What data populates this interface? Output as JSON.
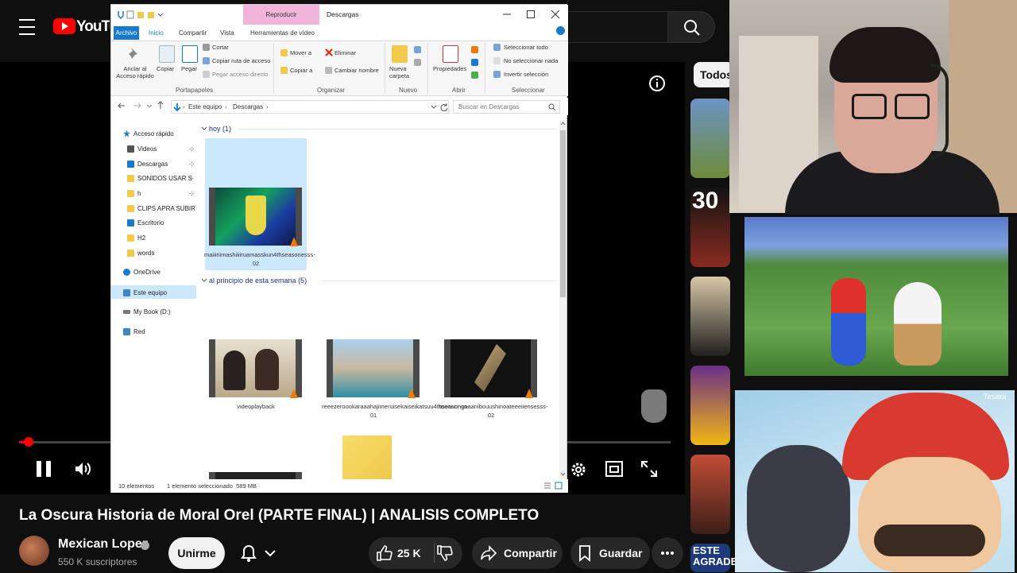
{
  "youtube": {
    "logo_text": "YouTube",
    "chip_all": "Todos",
    "video_title": "La Oscura Historia de Moral Orel (PARTE FINAL) | ANALISIS COMPLETO",
    "channel": "Mexican Lopez",
    "subscribers": "550 K suscriptores",
    "join_label": "Unirme",
    "likes": "25 K",
    "share_label": "Compartir",
    "save_label": "Guardar",
    "progress_fraction": 0.01,
    "rec_thumb_text": [
      "30",
      "ESTE",
      "AGRADE"
    ],
    "accent": "#ff0000"
  },
  "overlay": {
    "cartoon_tag": "Tesaka"
  },
  "explorer": {
    "title": "Descargas",
    "context_tab": "Reproducir",
    "tabs": [
      "Archivo",
      "Inicio",
      "Compartir",
      "Vista",
      "Herramientas de vídeo"
    ],
    "ribbon": {
      "pin": "Anclar al\nAcceso rápido",
      "copy": "Copiar",
      "paste": "Pegar",
      "cut": "Cortar",
      "copy_path": "Copiar ruta de acceso",
      "paste_shortcut": "Pegar acceso directo",
      "move_to": "Mover a",
      "copy_to": "Copiar a",
      "delete": "Eliminar",
      "rename": "Cambiar nombre",
      "new_folder": "Nueva\ncarpeta",
      "properties": "Propiedades",
      "select_all": "Seleccionar todo",
      "select_none": "No seleccionar nada",
      "invert": "Invertir selección",
      "groups": [
        "Portapapeles",
        "Organizar",
        "Nuevo",
        "Abrir",
        "Seleccionar"
      ]
    },
    "breadcrumb": [
      "Este equipo",
      "Descargas"
    ],
    "search_placeholder": "Buscar en Descargas",
    "nav": [
      "Acceso rápido",
      "Videos",
      "Descargas",
      "SONIDOS USAR S",
      "h",
      "CLIPS APRA SUBIR",
      "Escritorio",
      "H2",
      "words",
      "OneDrive",
      "Este equipo",
      "My Book (D:)",
      "Red"
    ],
    "groups": [
      {
        "label": "hoy (1)"
      },
      {
        "label": "al principio de esta semana (5)"
      }
    ],
    "files": [
      {
        "name": "maiiiriimashiiiiruamasskun4thseasonesss-02"
      },
      {
        "name": "videoplayback"
      },
      {
        "name": "reeezeroookaraaahajimeruisekaiseikatsuu4thseasonss-01"
      },
      {
        "name": "tooonnngaaariibouushinoateeeiiensesss-02"
      }
    ],
    "status_count": "10 elementos",
    "status_selection": "1 elemento seleccionado  589 MB",
    "colors": {
      "accent": "#1979ca",
      "selection": "#cce8ff",
      "context": "#f2b4db"
    }
  }
}
